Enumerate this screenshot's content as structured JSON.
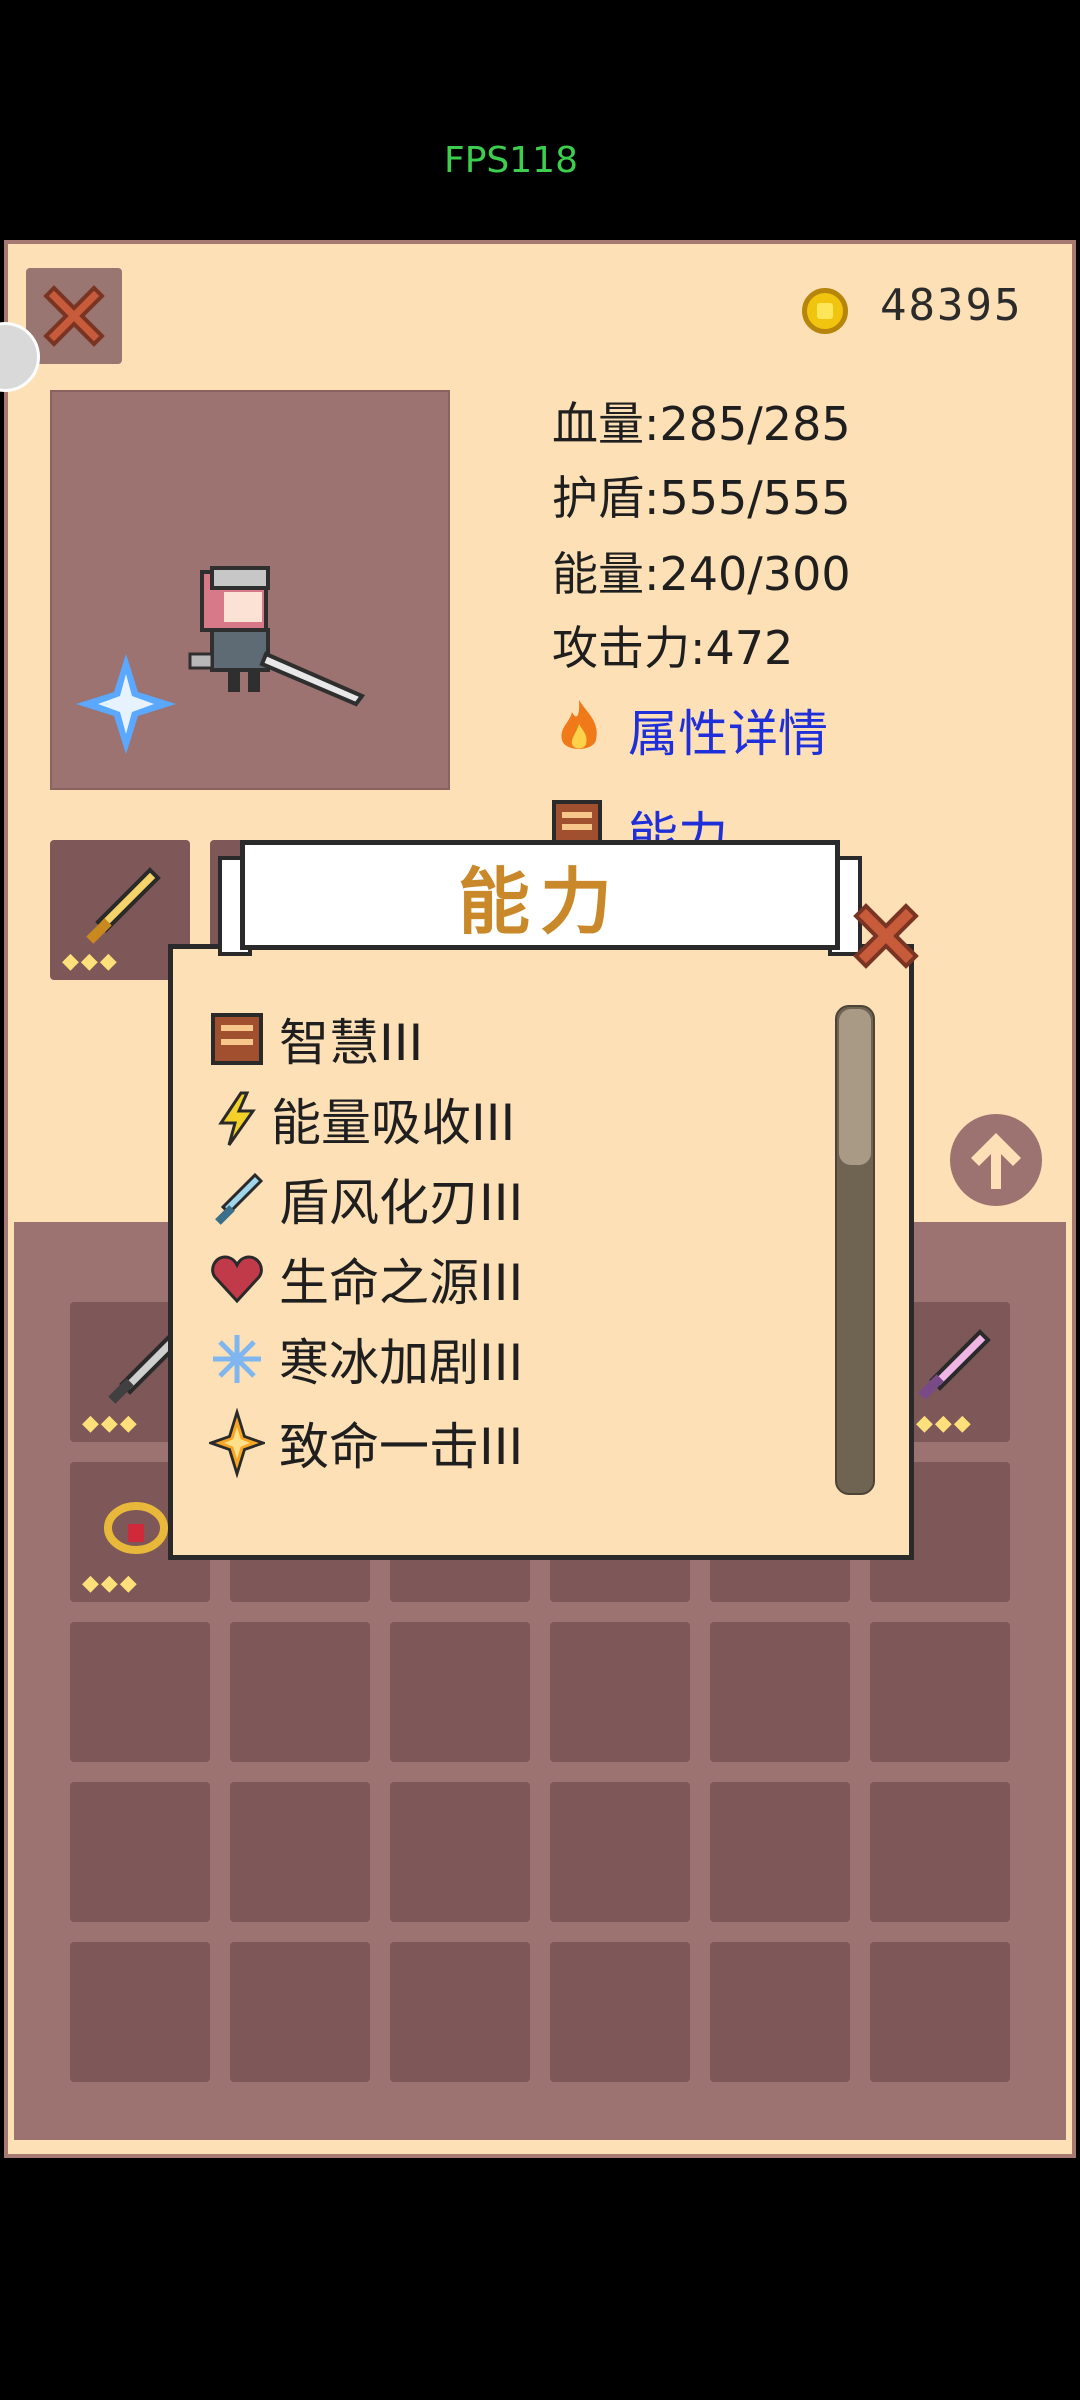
{
  "status": {
    "fps": "FPS118"
  },
  "header": {
    "coins": "48395"
  },
  "stats": {
    "hp": "血量:285/285",
    "shield": "护盾:555/555",
    "energy": "能量:240/300",
    "attack": "攻击力:472",
    "details_link": "属性详情",
    "ability_link": "能力"
  },
  "modal": {
    "title": "能力",
    "abilities": [
      {
        "label": "智慧III",
        "icon": "book-icon"
      },
      {
        "label": "能量吸收III",
        "icon": "lightning-icon"
      },
      {
        "label": "盾风化刃III",
        "icon": "sword-icon"
      },
      {
        "label": "生命之源III",
        "icon": "heart-icon"
      },
      {
        "label": "寒冰加剧III",
        "icon": "snowflake-icon"
      },
      {
        "label": "致命一击III",
        "icon": "star-burst-icon"
      }
    ]
  },
  "colors": {
    "panel": "#fde0b6",
    "slot": "#7e5759",
    "accent_title": "#c9892a",
    "link": "#1f2fd9"
  }
}
